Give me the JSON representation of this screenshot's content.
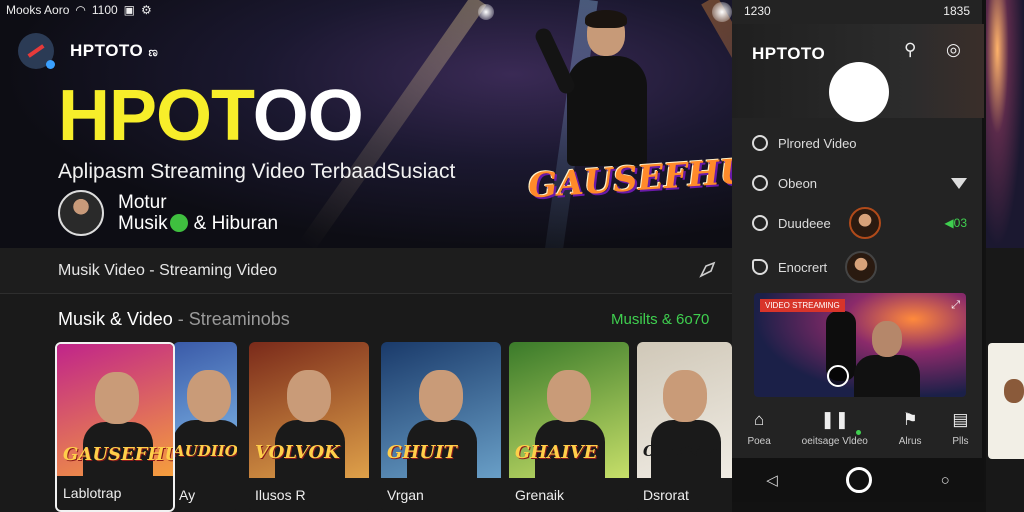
{
  "status": {
    "left": "Mooks Aoro",
    "time": "1100"
  },
  "app": {
    "name": "HPTOTO",
    "name_suffix": "ಣ"
  },
  "hero": {
    "brand_yellow": "HPOT",
    "brand_white": "OO",
    "tagline": "Aplipasm Streaming Video TerbaadSusiact",
    "genre_line1": "Motur",
    "genre_line2": "Musik",
    "genre_line3": "& Hiburan",
    "poster_title": "GAUSEFHUR"
  },
  "subbar": {
    "text": "Musik Video - Streaming Video"
  },
  "section": {
    "title": "Musik & Video",
    "title_suffix": "- Streaminobs",
    "link": "Musilts & 6o70"
  },
  "cards": [
    {
      "caption": "Lablotrap",
      "poster": "GAUSEFHUR",
      "color_a": "#c0248a",
      "color_b": "#f7a23a"
    },
    {
      "caption": "Ay",
      "poster": "AUDIIO",
      "color_a": "#3a5aa8",
      "color_b": "#88c4f0"
    },
    {
      "caption": "Ilusos R",
      "poster": "VOLVOK",
      "color_a": "#7a2a1a",
      "color_b": "#e0a24a"
    },
    {
      "caption": "Vrgan",
      "poster": "GHUIT",
      "color_a": "#1a3a6a",
      "color_b": "#6aa0c8"
    },
    {
      "caption": "Grenaik",
      "poster": "GHAIVE",
      "color_a": "#3a7a2a",
      "color_b": "#c8e06a"
    },
    {
      "caption": "Dsrorat",
      "poster": "OHBEAR",
      "color_a": "#d0c8b8",
      "color_b": "#f0ece4"
    }
  ],
  "phone": {
    "status_time": "1230",
    "status_right": "1835",
    "title": "HPTOTO",
    "rows": [
      {
        "label": "Plrored Video"
      },
      {
        "label": "Obeon"
      },
      {
        "label": "Duudeee",
        "badge": "◀03"
      },
      {
        "label": "Enocrert"
      }
    ],
    "video_tag": "VIDEO STREAMING",
    "nav": [
      {
        "label": "Poea"
      },
      {
        "label": "oeitsage Vldeo"
      },
      {
        "label": "Alrus"
      },
      {
        "label": "Plls"
      }
    ]
  },
  "colors": {
    "accent_green": "#3fcf4f",
    "brand_yellow": "#f7ee2a"
  }
}
